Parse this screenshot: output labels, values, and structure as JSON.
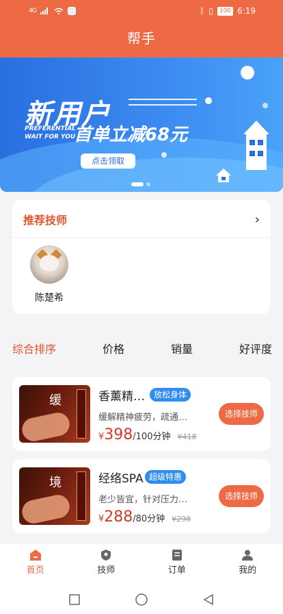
{
  "status_bar": {
    "network": "4G",
    "time": "6:19",
    "battery": "100"
  },
  "header": {
    "title": "帮手"
  },
  "banner": {
    "headline": "新用户",
    "en_line1": "PREFERENTIAL",
    "en_line2": "WAIT FOR YOU",
    "offer": "首单立减68元",
    "button": "点击领取"
  },
  "technicians": {
    "title": "推荐技师",
    "items": [
      {
        "name": "陈楚希"
      }
    ]
  },
  "sort_tabs": [
    "综合排序",
    "价格",
    "销量",
    "好评度"
  ],
  "services": [
    {
      "name": "香薰精…",
      "tag": "放松身体",
      "desc": "缓解精神疲劳，疏通…",
      "currency": "¥",
      "price": "398",
      "duration": "/100分钟",
      "old_price": "¥418",
      "button": "选择技师",
      "thumb_glyph": "缓"
    },
    {
      "name": "经络SPA",
      "tag": "超级特惠",
      "desc": "老少皆宜，针对压力…",
      "currency": "¥",
      "price": "288",
      "duration": "/80分钟",
      "old_price": "¥298",
      "button": "选择技师",
      "thumb_glyph": "境"
    }
  ],
  "tabbar": [
    {
      "label": "首页",
      "icon": "home-icon",
      "active": true
    },
    {
      "label": "技师",
      "icon": "shield-icon",
      "active": false
    },
    {
      "label": "订单",
      "icon": "order-icon",
      "active": false
    },
    {
      "label": "我的",
      "icon": "user-icon",
      "active": false
    }
  ],
  "colors": {
    "brand": "#ee6a45",
    "tag": "#2f8cf0",
    "price": "#d03a2a"
  }
}
